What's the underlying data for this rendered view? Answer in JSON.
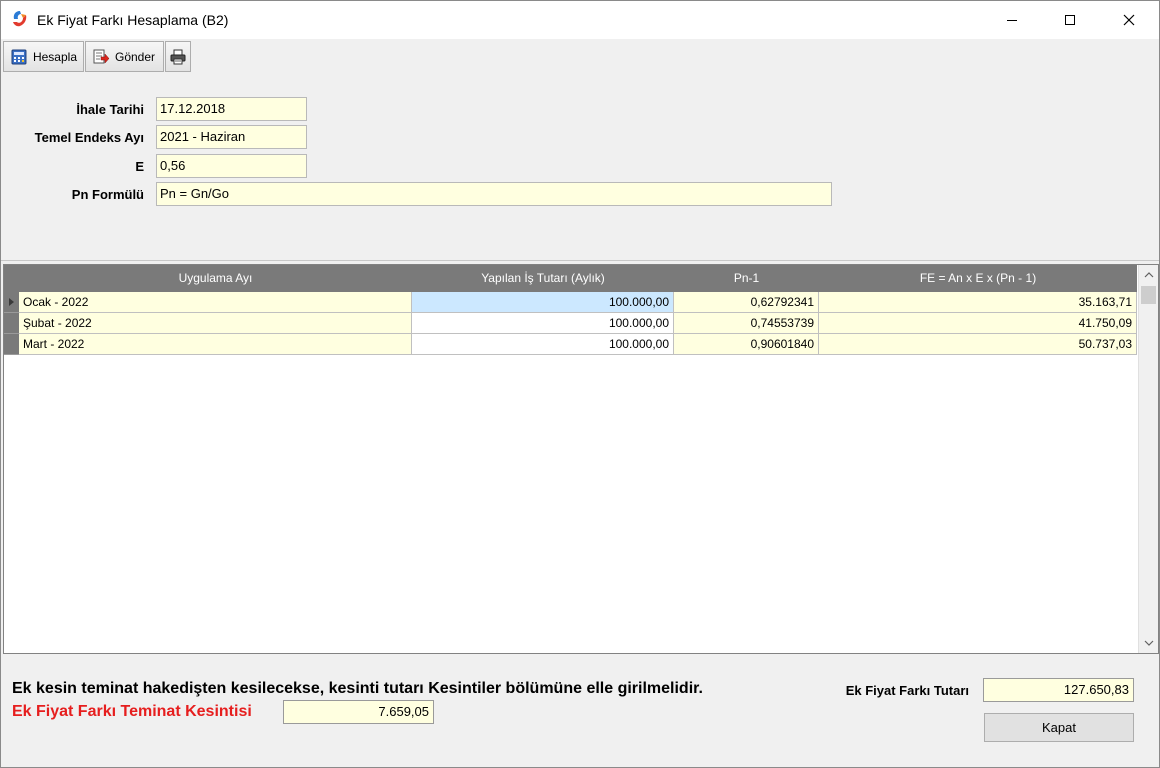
{
  "window": {
    "title": "Ek Fiyat Farkı Hesaplama (B2)",
    "icons": [
      "app-icon",
      "minimize-icon",
      "maximize-icon",
      "close-icon"
    ]
  },
  "toolbar": {
    "hesapla_label": "Hesapla",
    "gonder_label": "Gönder"
  },
  "form": {
    "ihale_tarihi_label": "İhale Tarihi",
    "ihale_tarihi_value": "17.12.2018",
    "temel_endeks_label": "Temel Endeks Ayı",
    "temel_endeks_value": "2021 - Haziran",
    "e_label": "E",
    "e_value": "0,56",
    "pn_formulu_label": "Pn Formülü",
    "pn_formulu_value": "Pn = Gn/Go"
  },
  "grid": {
    "columns": [
      "Uygulama Ayı",
      "Yapılan İş Tutarı (Aylık)",
      "Pn-1",
      "FE = An x E x (Pn - 1)"
    ],
    "rows": [
      {
        "ay": "Ocak - 2022",
        "tutar": "100.000,00",
        "pn": "0,62792341",
        "fe": "35.163,71"
      },
      {
        "ay": "Şubat - 2022",
        "tutar": "100.000,00",
        "pn": "0,74553739",
        "fe": "41.750,09"
      },
      {
        "ay": "Mart - 2022",
        "tutar": "100.000,00",
        "pn": "0,90601840",
        "fe": "50.737,03"
      }
    ]
  },
  "bottom": {
    "note": "Ek kesin teminat hakedişten kesilecekse, kesinti tutarı Kesintiler bölümüne elle girilmelidir.",
    "teminat_label": "Ek Fiyat Farkı Teminat Kesintisi",
    "teminat_value": "7.659,05",
    "total_label": "Ek Fiyat Farkı Tutarı",
    "total_value": "127.650,83",
    "kapat_label": "Kapat"
  },
  "colors": {
    "field_bg": "#ffffe0",
    "header_bg": "#7a7a7a",
    "selection": "#cce8ff",
    "warning_red": "#e61e1e"
  }
}
